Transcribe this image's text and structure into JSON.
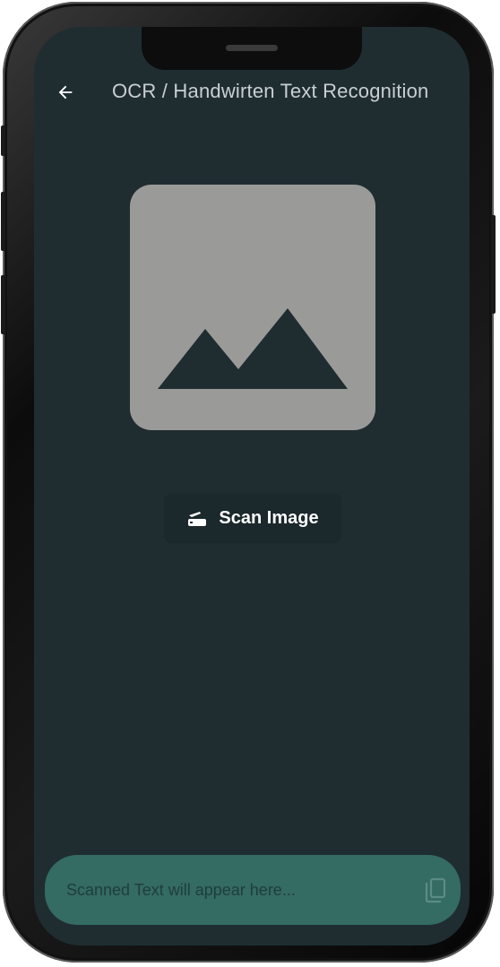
{
  "app": {
    "title": "OCR / Handwirten Text Recognition"
  },
  "icons": {
    "back": "arrow-back-icon",
    "placeholder": "image-placeholder-icon",
    "scan": "document-scanner-icon",
    "copy": "copy-icon"
  },
  "scan_button": {
    "label": "Scan Image"
  },
  "output": {
    "placeholder": "Scanned Text will appear here..."
  },
  "colors": {
    "background": "#1f2d31",
    "placeholder_image": "#9a9b99",
    "output_panel": "#346b62"
  }
}
